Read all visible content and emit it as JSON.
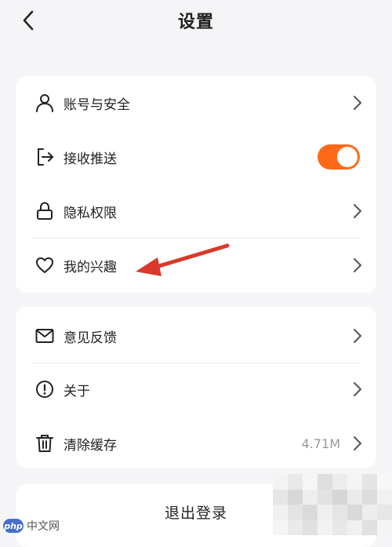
{
  "header": {
    "title": "设置",
    "back_icon": "chevron-left-icon"
  },
  "group1": {
    "items": [
      {
        "label": "账号与安全",
        "icon": "user-icon",
        "trailing": "chevron"
      },
      {
        "label": "接收推送",
        "icon": "logout-arrow-icon",
        "trailing": "toggle",
        "toggle_on": true
      },
      {
        "label": "隐私权限",
        "icon": "lock-icon",
        "trailing": "chevron"
      },
      {
        "label": "我的兴趣",
        "icon": "heart-icon",
        "trailing": "chevron"
      }
    ]
  },
  "group2": {
    "items": [
      {
        "label": "意见反馈",
        "icon": "mail-icon",
        "trailing": "chevron"
      },
      {
        "label": "关于",
        "icon": "info-circle-icon",
        "trailing": "chevron"
      },
      {
        "label": "清除缓存",
        "icon": "trash-icon",
        "trailing": "chevron",
        "value": "4.71M"
      }
    ]
  },
  "logout": {
    "label": "退出登录"
  },
  "colors": {
    "accent": "#ff6a1a",
    "arrow": "#d9392b",
    "background": "#f5f5f7"
  },
  "watermark": {
    "badge": "php",
    "text": "中文网"
  }
}
